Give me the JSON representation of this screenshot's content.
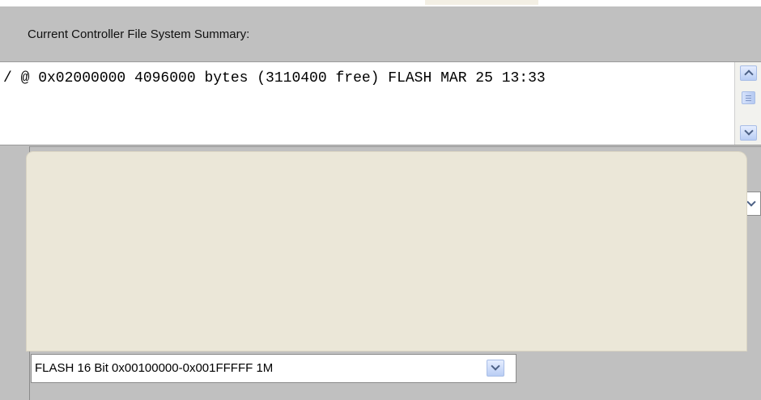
{
  "summary": {
    "label": "Current Controller File System Summary:",
    "text": "/ @ 0x02000000 4096000 bytes (3110400 free) FLASH MAR 25 13:33"
  },
  "memory_select": {
    "selected": "FLASH 16 Bit 0x00100000-0x001FFFFF 1M"
  },
  "icons": {
    "scroll_up": "chevron-up-icon",
    "scroll_down": "chevron-down-icon",
    "combo_arrow": "chevron-down-icon"
  },
  "colors": {
    "background": "#c0c0c0",
    "overlay": "#ebe7d8",
    "scroll_accent": "#b9cdf4"
  }
}
